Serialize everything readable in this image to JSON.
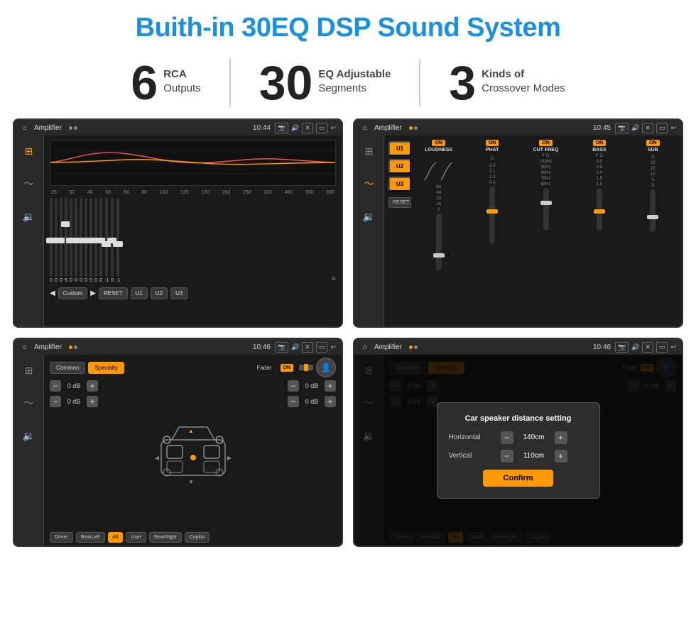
{
  "header": {
    "title": "Buith-in 30EQ DSP Sound System"
  },
  "stats": [
    {
      "number": "6",
      "label_bold": "RCA",
      "label": "Outputs"
    },
    {
      "number": "30",
      "label_bold": "EQ Adjustable",
      "label": "Segments"
    },
    {
      "number": "3",
      "label_bold": "Kinds of",
      "label": "Crossover Modes"
    }
  ],
  "screens": [
    {
      "id": "screen1",
      "status": {
        "title": "Amplifier",
        "time": "10:44"
      },
      "eq_labels": [
        "25",
        "32",
        "40",
        "50",
        "63",
        "80",
        "100",
        "125",
        "160",
        "200",
        "250",
        "320",
        "400",
        "500",
        "630"
      ],
      "eq_values": [
        "0",
        "0",
        "0",
        "5",
        "0",
        "0",
        "0",
        "0",
        "0",
        "0",
        "0",
        "-1",
        "0",
        "-1"
      ],
      "bottom_btns": [
        "Custom",
        "RESET",
        "U1",
        "U2",
        "U3"
      ]
    },
    {
      "id": "screen2",
      "status": {
        "title": "Amplifier",
        "time": "10:45"
      },
      "presets": [
        "U1",
        "U2",
        "U3"
      ],
      "channels": [
        {
          "on": true,
          "name": "LOUDNESS"
        },
        {
          "on": true,
          "name": "PHAT"
        },
        {
          "on": true,
          "name": "CUT FREQ"
        },
        {
          "on": true,
          "name": "BASS"
        },
        {
          "on": true,
          "name": "SUB"
        }
      ],
      "reset_label": "RESET"
    },
    {
      "id": "screen3",
      "status": {
        "title": "Amplifier",
        "time": "10:46"
      },
      "tabs": [
        "Common",
        "Specialty"
      ],
      "active_tab": 1,
      "fader_label": "Fader",
      "toggle_label": "ON",
      "volume_rows": [
        {
          "value": "0 dB"
        },
        {
          "value": "0 dB"
        },
        {
          "value": "0 dB"
        },
        {
          "value": "0 dB"
        }
      ],
      "bottom_btns": [
        "Driver",
        "RearLeft",
        "All",
        "User",
        "RearRight",
        "Copilot"
      ]
    },
    {
      "id": "screen4",
      "status": {
        "title": "Amplifier",
        "time": "10:46"
      },
      "tabs": [
        "Common",
        "Specialty"
      ],
      "active_tab": 1,
      "fader_label": "Fader",
      "toggle_label": "ON",
      "dialog": {
        "title": "Car speaker distance setting",
        "rows": [
          {
            "label": "Horizontal",
            "value": "140cm"
          },
          {
            "label": "Vertical",
            "value": "110cm"
          }
        ],
        "confirm_label": "Confirm"
      },
      "bottom_btns": [
        "Driver",
        "RearLeft",
        "All",
        "User",
        "RearRight",
        "Copilot"
      ]
    }
  ]
}
